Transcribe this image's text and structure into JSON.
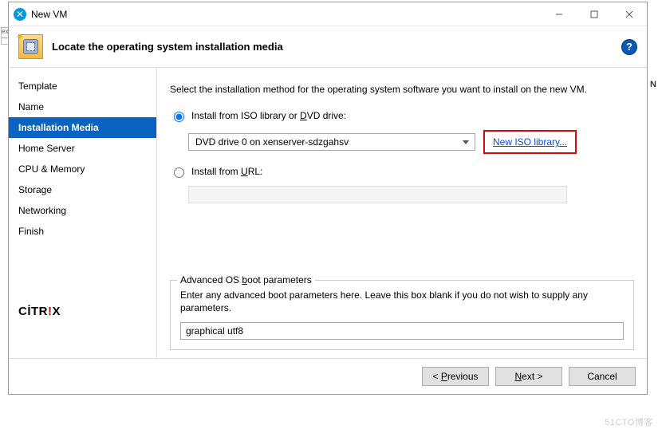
{
  "titlebar": {
    "title": "New VM"
  },
  "header": {
    "title": "Locate the operating system installation media"
  },
  "sidebar": {
    "items": [
      {
        "label": "Template",
        "active": false
      },
      {
        "label": "Name",
        "active": false
      },
      {
        "label": "Installation Media",
        "active": true
      },
      {
        "label": "Home Server",
        "active": false
      },
      {
        "label": "CPU & Memory",
        "active": false
      },
      {
        "label": "Storage",
        "active": false
      },
      {
        "label": "Networking",
        "active": false
      },
      {
        "label": "Finish",
        "active": false
      }
    ],
    "logo_prefix": "CİTR",
    "logo_suffix": "X"
  },
  "content": {
    "instruction": "Select the installation method for the operating system software you want to install on the new VM.",
    "opt_iso_label_pre": "Install from ISO library or ",
    "opt_iso_access": "D",
    "opt_iso_label_post": "VD drive:",
    "dvd_selected": "DVD drive 0 on xenserver-sdzgahsv",
    "iso_link_pre": "",
    "iso_link_access": "N",
    "iso_link_post": "ew ISO library...",
    "opt_url_label_pre": "Install from ",
    "opt_url_access": "U",
    "opt_url_label_post": "RL:",
    "url_value": "",
    "fieldset": {
      "legend_pre": "Advanced OS ",
      "legend_access": "b",
      "legend_post": "oot parameters",
      "help": "Enter any advanced boot parameters here. Leave this box blank if you do not wish to supply any parameters.",
      "value": "graphical utf8"
    }
  },
  "footer": {
    "prev_pre": "< ",
    "prev_access": "P",
    "prev_post": "revious",
    "next_access": "N",
    "next_post": "ext >",
    "cancel": "Cancel"
  },
  "right_edge": {
    "char": "N"
  },
  "watermark": "51CTO博客"
}
